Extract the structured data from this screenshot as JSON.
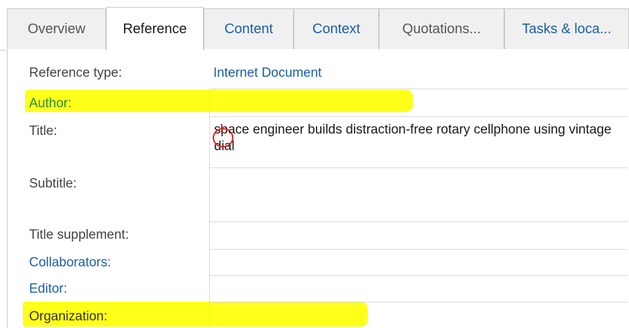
{
  "tabs": [
    {
      "label": "Overview",
      "style": "gray"
    },
    {
      "label": "Reference",
      "style": "active"
    },
    {
      "label": "Content",
      "style": "link"
    },
    {
      "label": "Context",
      "style": "link"
    },
    {
      "label": "Quotations...",
      "style": "gray"
    },
    {
      "label": "Tasks & loca...",
      "style": "link"
    }
  ],
  "reference": {
    "type_label": "Reference type:",
    "type_value": "Internet Document",
    "fields": [
      {
        "label": "Author:",
        "value": "",
        "highlighted": true
      },
      {
        "label": "Title:",
        "value": "space engineer builds distraction-free rotary cellphone using vintage dial"
      },
      {
        "label": "Subtitle:",
        "value": ""
      },
      {
        "label": "Title supplement:",
        "value": ""
      },
      {
        "label": "Collaborators:",
        "value": ""
      },
      {
        "label": "Editor:",
        "value": ""
      },
      {
        "label": "Organization:",
        "value": "",
        "highlighted": true
      }
    ]
  },
  "colors": {
    "highlight": "#ffff1a",
    "link": "#1c5ea8",
    "annotation_circle": "#e02020"
  }
}
